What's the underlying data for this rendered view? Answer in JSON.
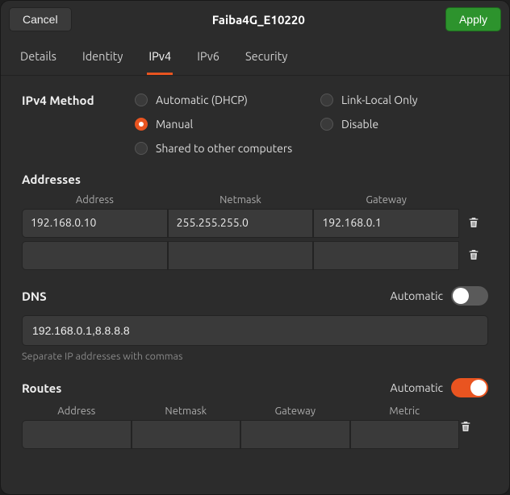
{
  "header": {
    "cancel": "Cancel",
    "title": "Faiba4G_E10220",
    "apply": "Apply"
  },
  "tabs": [
    "Details",
    "Identity",
    "IPv4",
    "IPv6",
    "Security"
  ],
  "active_tab": "IPv4",
  "method": {
    "label": "IPv4 Method",
    "options": {
      "auto": "Automatic (DHCP)",
      "linklocal": "Link-Local Only",
      "manual": "Manual",
      "disable": "Disable",
      "shared": "Shared to other computers"
    },
    "selected": "manual"
  },
  "addresses": {
    "heading": "Addresses",
    "cols": {
      "address": "Address",
      "netmask": "Netmask",
      "gateway": "Gateway"
    },
    "rows": [
      {
        "address": "192.168.0.10",
        "netmask": "255.255.255.0",
        "gateway": "192.168.0.1"
      },
      {
        "address": "",
        "netmask": "",
        "gateway": ""
      }
    ]
  },
  "dns": {
    "heading": "DNS",
    "auto_label": "Automatic",
    "auto_on": false,
    "value": "192.168.0.1,8.8.8.8",
    "hint": "Separate IP addresses with commas"
  },
  "routes": {
    "heading": "Routes",
    "auto_label": "Automatic",
    "auto_on": true,
    "cols": {
      "address": "Address",
      "netmask": "Netmask",
      "gateway": "Gateway",
      "metric": "Metric"
    },
    "rows": [
      {
        "address": "",
        "netmask": "",
        "gateway": "",
        "metric": ""
      }
    ]
  }
}
